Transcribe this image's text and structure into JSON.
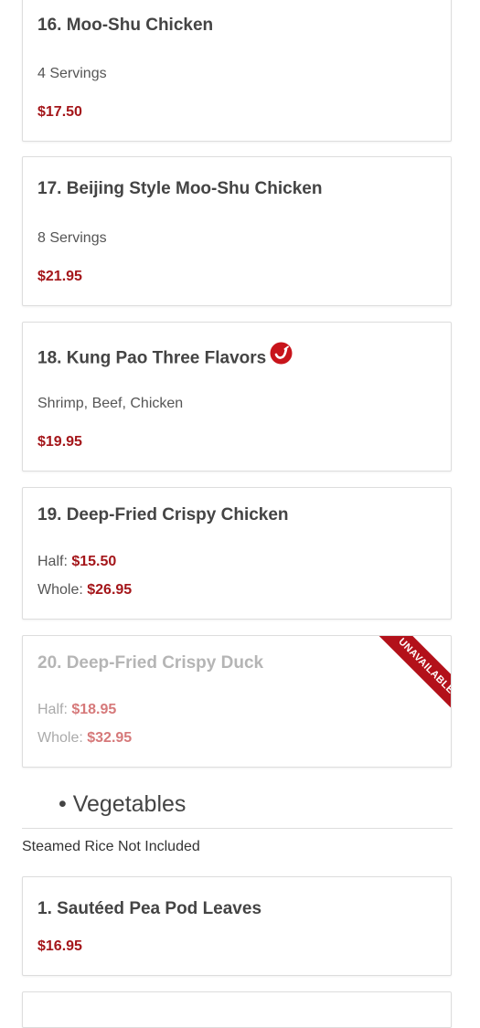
{
  "items": [
    {
      "title": "16. Moo-Shu Chicken",
      "desc": "4 Servings",
      "price": "$17.50"
    },
    {
      "title": "17. Beijing Style Moo-Shu Chicken",
      "desc": "8 Servings",
      "price": "$21.95"
    },
    {
      "title": "18. Kung Pao Three Flavors",
      "desc": "Shrimp, Beef, Chicken",
      "price": "$19.95",
      "icon": "spicy-pepper-icon"
    },
    {
      "title": "19. Deep-Fried Crispy Chicken",
      "half_label": "Half:",
      "half_price": "$15.50",
      "whole_label": "Whole:",
      "whole_price": "$26.95"
    },
    {
      "title": "20. Deep-Fried Crispy Duck",
      "half_label": "Half:",
      "half_price": "$18.95",
      "whole_label": "Whole:",
      "whole_price": "$32.95",
      "badge": "Unavailable"
    }
  ],
  "section": {
    "heading": "• Vegetables",
    "note": "Steamed Rice Not Included"
  },
  "veg_items": [
    {
      "title": "1. Sautéed Pea Pod Leaves",
      "price": "$16.95"
    }
  ],
  "colors": {
    "price": "#a4161a",
    "badge": "#b3111a"
  }
}
